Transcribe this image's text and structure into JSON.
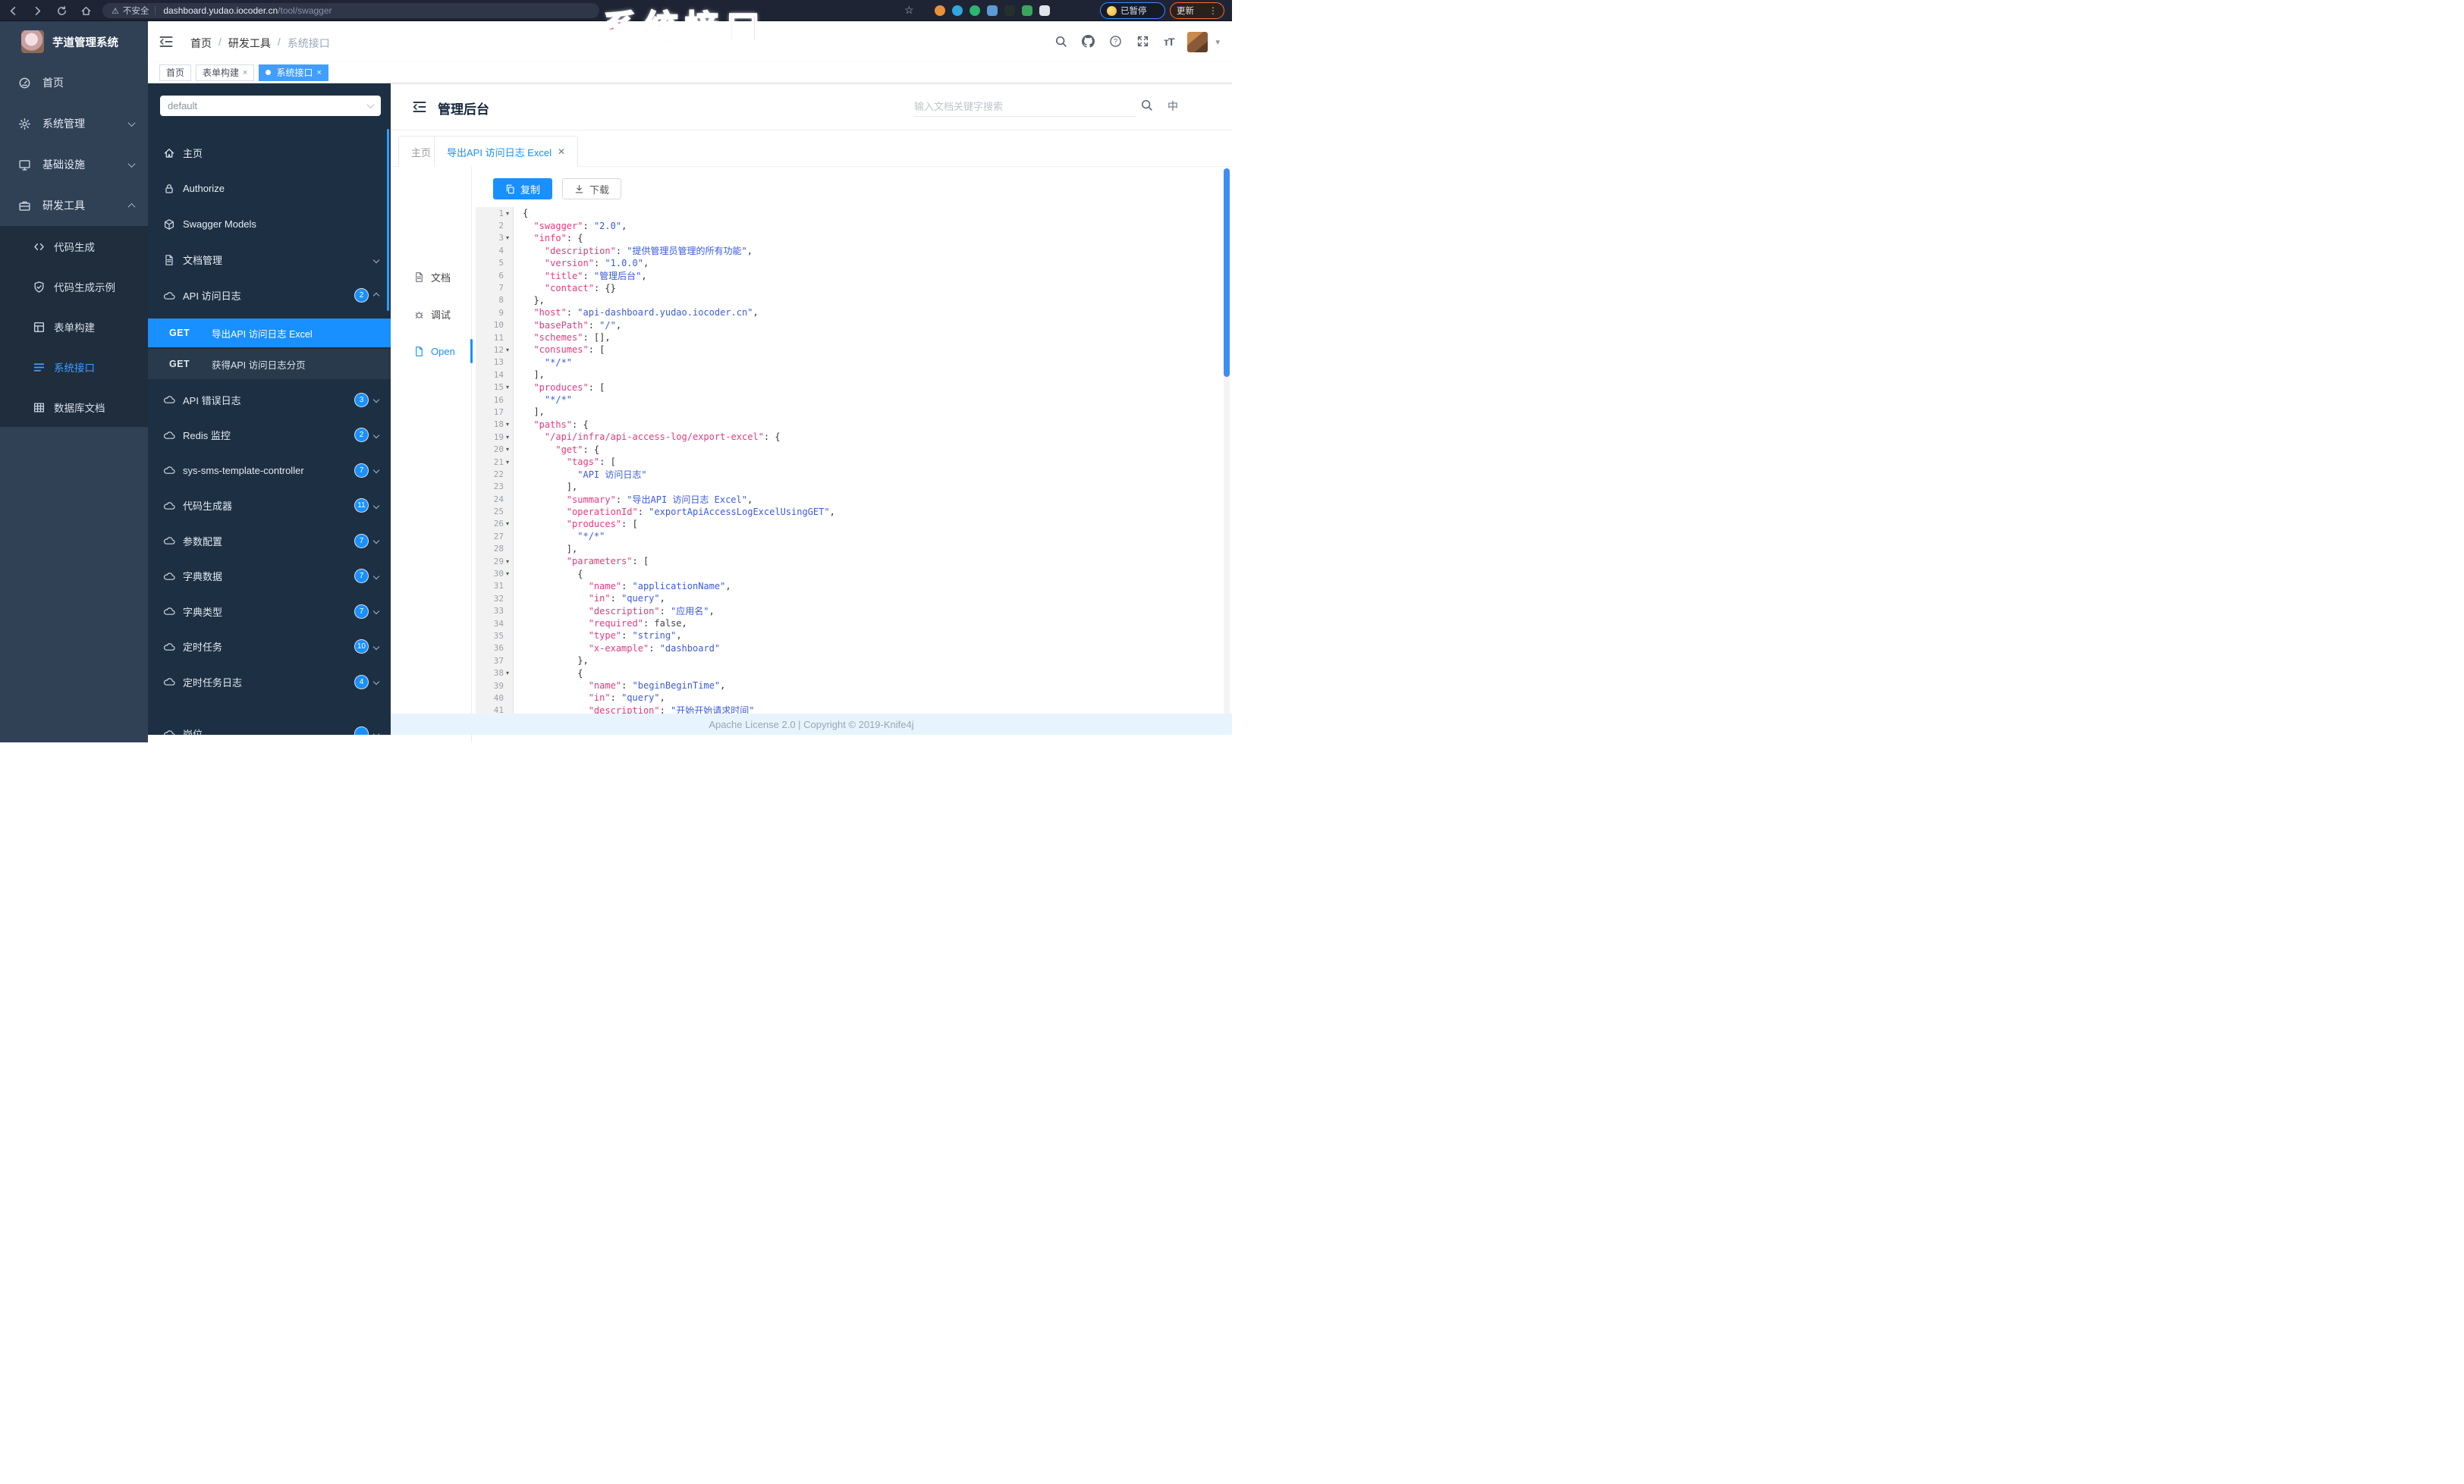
{
  "colors": {
    "accent": "#1890ff",
    "sidebar_active": "#409eff",
    "code_key": "#e5397f",
    "code_string": "#3b5bdb",
    "watermark_pink": "#f4466f",
    "sidebar_bg": "#304156",
    "submenu_bg": "#1f2d3d",
    "panel_bg": "#1d3043"
  },
  "watermark": "系统接口",
  "browser": {
    "security_label": "不安全",
    "url_domain": "dashboard.yudao.iocoder.cn",
    "url_path": "/tool/swagger",
    "paused_label": "已暂停",
    "update_label": "更新",
    "extensions": [
      {
        "name": "extension-orange",
        "color": "#e8913c"
      },
      {
        "name": "extension-blue-drop",
        "color": "#2fa8e0"
      },
      {
        "name": "extension-green-circle",
        "color": "#2bb673"
      },
      {
        "name": "extension-blue-grid",
        "color": "#5b9bd5"
      },
      {
        "name": "extension-dark-green",
        "color": "#23312a"
      },
      {
        "name": "extension-green",
        "color": "#3ba55d"
      },
      {
        "name": "extension-light-puzzle",
        "color": "#dfe5ea"
      }
    ]
  },
  "sidebar": {
    "logo_title": "芋道管理系统",
    "items": [
      {
        "label": "首页",
        "icon": "dashboard-icon"
      },
      {
        "label": "系统管理",
        "icon": "gear-icon",
        "chevron": "down"
      },
      {
        "label": "基础设施",
        "icon": "monitor-icon",
        "chevron": "down"
      },
      {
        "label": "研发工具",
        "icon": "tools-icon",
        "chevron": "up",
        "open": true,
        "children": [
          {
            "label": "代码生成",
            "icon": "code-icon"
          },
          {
            "label": "代码生成示例",
            "icon": "shield-check-icon"
          },
          {
            "label": "表单构建",
            "icon": "form-icon"
          },
          {
            "label": "系统接口",
            "icon": "swagger-icon",
            "active": true
          },
          {
            "label": "数据库文档",
            "icon": "database-icon"
          }
        ]
      }
    ]
  },
  "navbar": {
    "breadcrumb": [
      "首页",
      "研发工具",
      "系统接口"
    ],
    "right_icons": [
      "search-icon",
      "github-icon",
      "question-icon",
      "fullscreen-icon",
      "fontsize-icon"
    ]
  },
  "tags": [
    {
      "label": "首页",
      "closable": false,
      "active": false
    },
    {
      "label": "表单构建",
      "closable": true,
      "active": false
    },
    {
      "label": "系统接口",
      "closable": true,
      "active": true
    }
  ],
  "panel": {
    "group_select": "default",
    "nav": [
      {
        "label": "主页",
        "icon": "home-icon"
      },
      {
        "label": "Authorize",
        "icon": "lock-icon"
      },
      {
        "label": "Swagger Models",
        "icon": "cube-icon"
      },
      {
        "label": "文档管理",
        "icon": "doc-icon",
        "chevron": "down"
      },
      {
        "label": "API 访问日志",
        "icon": "cloud-icon",
        "badge": "2",
        "chevron": "up"
      }
    ],
    "operations": [
      {
        "method": "GET",
        "label": "导出API 访问日志 Excel",
        "active": true
      },
      {
        "method": "GET",
        "label": "获得API 访问日志分页",
        "active": false
      }
    ],
    "groups": [
      {
        "label": "API 错误日志",
        "badge": "3"
      },
      {
        "label": "Redis 监控",
        "badge": "2"
      },
      {
        "label": "sys-sms-template-controller",
        "badge": "7"
      },
      {
        "label": "代码生成器",
        "badge": "11"
      },
      {
        "label": "参数配置",
        "badge": "7"
      },
      {
        "label": "字典数据",
        "badge": "7"
      },
      {
        "label": "字典类型",
        "badge": "7"
      },
      {
        "label": "定时任务",
        "badge": "10"
      },
      {
        "label": "定时任务日志",
        "badge": "4"
      },
      {
        "label": "岗位",
        "badge": ""
      }
    ]
  },
  "doc": {
    "title": "管理后台",
    "search_placeholder": "输入文档关键字搜索",
    "lang_label": "中",
    "tabs": [
      {
        "label": "主页",
        "closable": false,
        "active": false
      },
      {
        "label": "导出API 访问日志 Excel",
        "closable": true,
        "active": true
      }
    ],
    "mini_nav": [
      {
        "label": "文档",
        "icon": "doc-icon",
        "active": false
      },
      {
        "label": "调试",
        "icon": "debug-icon",
        "active": false
      },
      {
        "label": "Open",
        "icon": "file-icon",
        "active": true
      }
    ],
    "copy_label": "复制",
    "download_label": "下载",
    "footer": "Apache License 2.0 | Copyright © 2019-Knife4j"
  },
  "code": {
    "lines": [
      {
        "n": 1,
        "f": true,
        "t": [
          [
            "p",
            "{"
          ]
        ]
      },
      {
        "n": 2,
        "f": false,
        "t": [
          [
            "p",
            "  "
          ],
          [
            "k",
            "\"swagger\""
          ],
          [
            "p",
            ": "
          ],
          [
            "s",
            "\"2.0\""
          ],
          [
            "p",
            ","
          ]
        ]
      },
      {
        "n": 3,
        "f": true,
        "t": [
          [
            "p",
            "  "
          ],
          [
            "k",
            "\"info\""
          ],
          [
            "p",
            ": {"
          ]
        ]
      },
      {
        "n": 4,
        "f": false,
        "t": [
          [
            "p",
            "    "
          ],
          [
            "k",
            "\"description\""
          ],
          [
            "p",
            ": "
          ],
          [
            "s",
            "\"提供管理员管理的所有功能\""
          ],
          [
            "p",
            ","
          ]
        ]
      },
      {
        "n": 5,
        "f": false,
        "t": [
          [
            "p",
            "    "
          ],
          [
            "k",
            "\"version\""
          ],
          [
            "p",
            ": "
          ],
          [
            "s",
            "\"1.0.0\""
          ],
          [
            "p",
            ","
          ]
        ]
      },
      {
        "n": 6,
        "f": false,
        "t": [
          [
            "p",
            "    "
          ],
          [
            "k",
            "\"title\""
          ],
          [
            "p",
            ": "
          ],
          [
            "s",
            "\"管理后台\""
          ],
          [
            "p",
            ","
          ]
        ]
      },
      {
        "n": 7,
        "f": false,
        "t": [
          [
            "p",
            "    "
          ],
          [
            "k",
            "\"contact\""
          ],
          [
            "p",
            ": {}"
          ]
        ]
      },
      {
        "n": 8,
        "f": false,
        "t": [
          [
            "p",
            "  },"
          ]
        ]
      },
      {
        "n": 9,
        "f": false,
        "t": [
          [
            "p",
            "  "
          ],
          [
            "k",
            "\"host\""
          ],
          [
            "p",
            ": "
          ],
          [
            "s",
            "\"api-dashboard.yudao.iocoder.cn\""
          ],
          [
            "p",
            ","
          ]
        ]
      },
      {
        "n": 10,
        "f": false,
        "t": [
          [
            "p",
            "  "
          ],
          [
            "k",
            "\"basePath\""
          ],
          [
            "p",
            ": "
          ],
          [
            "s",
            "\"/\""
          ],
          [
            "p",
            ","
          ]
        ]
      },
      {
        "n": 11,
        "f": false,
        "t": [
          [
            "p",
            "  "
          ],
          [
            "k",
            "\"schemes\""
          ],
          [
            "p",
            ": [],"
          ]
        ]
      },
      {
        "n": 12,
        "f": true,
        "t": [
          [
            "p",
            "  "
          ],
          [
            "k",
            "\"consumes\""
          ],
          [
            "p",
            ": ["
          ]
        ]
      },
      {
        "n": 13,
        "f": false,
        "t": [
          [
            "p",
            "    "
          ],
          [
            "s",
            "\"*/*\""
          ]
        ]
      },
      {
        "n": 14,
        "f": false,
        "t": [
          [
            "p",
            "  ],"
          ]
        ]
      },
      {
        "n": 15,
        "f": true,
        "t": [
          [
            "p",
            "  "
          ],
          [
            "k",
            "\"produces\""
          ],
          [
            "p",
            ": ["
          ]
        ]
      },
      {
        "n": 16,
        "f": false,
        "t": [
          [
            "p",
            "    "
          ],
          [
            "s",
            "\"*/*\""
          ]
        ]
      },
      {
        "n": 17,
        "f": false,
        "t": [
          [
            "p",
            "  ],"
          ]
        ]
      },
      {
        "n": 18,
        "f": true,
        "t": [
          [
            "p",
            "  "
          ],
          [
            "k",
            "\"paths\""
          ],
          [
            "p",
            ": {"
          ]
        ]
      },
      {
        "n": 19,
        "f": true,
        "t": [
          [
            "p",
            "    "
          ],
          [
            "k",
            "\"/api/infra/api-access-log/export-excel\""
          ],
          [
            "p",
            ": {"
          ]
        ]
      },
      {
        "n": 20,
        "f": true,
        "t": [
          [
            "p",
            "      "
          ],
          [
            "k",
            "\"get\""
          ],
          [
            "p",
            ": {"
          ]
        ]
      },
      {
        "n": 21,
        "f": true,
        "t": [
          [
            "p",
            "        "
          ],
          [
            "k",
            "\"tags\""
          ],
          [
            "p",
            ": ["
          ]
        ]
      },
      {
        "n": 22,
        "f": false,
        "t": [
          [
            "p",
            "          "
          ],
          [
            "s",
            "\"API 访问日志\""
          ]
        ]
      },
      {
        "n": 23,
        "f": false,
        "t": [
          [
            "p",
            "        ],"
          ]
        ]
      },
      {
        "n": 24,
        "f": false,
        "t": [
          [
            "p",
            "        "
          ],
          [
            "k",
            "\"summary\""
          ],
          [
            "p",
            ": "
          ],
          [
            "s",
            "\"导出API 访问日志 Excel\""
          ],
          [
            "p",
            ","
          ]
        ]
      },
      {
        "n": 25,
        "f": false,
        "t": [
          [
            "p",
            "        "
          ],
          [
            "k",
            "\"operationId\""
          ],
          [
            "p",
            ": "
          ],
          [
            "s",
            "\"exportApiAccessLogExcelUsingGET\""
          ],
          [
            "p",
            ","
          ]
        ]
      },
      {
        "n": 26,
        "f": true,
        "t": [
          [
            "p",
            "        "
          ],
          [
            "k",
            "\"produces\""
          ],
          [
            "p",
            ": ["
          ]
        ]
      },
      {
        "n": 27,
        "f": false,
        "t": [
          [
            "p",
            "          "
          ],
          [
            "s",
            "\"*/*\""
          ]
        ]
      },
      {
        "n": 28,
        "f": false,
        "t": [
          [
            "p",
            "        ],"
          ]
        ]
      },
      {
        "n": 29,
        "f": true,
        "t": [
          [
            "p",
            "        "
          ],
          [
            "k",
            "\"parameters\""
          ],
          [
            "p",
            ": ["
          ]
        ]
      },
      {
        "n": 30,
        "f": true,
        "t": [
          [
            "p",
            "          {"
          ]
        ]
      },
      {
        "n": 31,
        "f": false,
        "t": [
          [
            "p",
            "            "
          ],
          [
            "k",
            "\"name\""
          ],
          [
            "p",
            ": "
          ],
          [
            "s",
            "\"applicationName\""
          ],
          [
            "p",
            ","
          ]
        ]
      },
      {
        "n": 32,
        "f": false,
        "t": [
          [
            "p",
            "            "
          ],
          [
            "k",
            "\"in\""
          ],
          [
            "p",
            ": "
          ],
          [
            "s",
            "\"query\""
          ],
          [
            "p",
            ","
          ]
        ]
      },
      {
        "n": 33,
        "f": false,
        "t": [
          [
            "p",
            "            "
          ],
          [
            "k",
            "\"description\""
          ],
          [
            "p",
            ": "
          ],
          [
            "s",
            "\"应用名\""
          ],
          [
            "p",
            ","
          ]
        ]
      },
      {
        "n": 34,
        "f": false,
        "t": [
          [
            "p",
            "            "
          ],
          [
            "k",
            "\"required\""
          ],
          [
            "p",
            ": "
          ],
          [
            "b",
            "false"
          ],
          [
            "p",
            ","
          ]
        ]
      },
      {
        "n": 35,
        "f": false,
        "t": [
          [
            "p",
            "            "
          ],
          [
            "k",
            "\"type\""
          ],
          [
            "p",
            ": "
          ],
          [
            "s",
            "\"string\""
          ],
          [
            "p",
            ","
          ]
        ]
      },
      {
        "n": 36,
        "f": false,
        "t": [
          [
            "p",
            "            "
          ],
          [
            "k",
            "\"x-example\""
          ],
          [
            "p",
            ": "
          ],
          [
            "s",
            "\"dashboard\""
          ]
        ]
      },
      {
        "n": 37,
        "f": false,
        "t": [
          [
            "p",
            "          },"
          ]
        ]
      },
      {
        "n": 38,
        "f": true,
        "t": [
          [
            "p",
            "          {"
          ]
        ]
      },
      {
        "n": 39,
        "f": false,
        "t": [
          [
            "p",
            "            "
          ],
          [
            "k",
            "\"name\""
          ],
          [
            "p",
            ": "
          ],
          [
            "s",
            "\"beginBeginTime\""
          ],
          [
            "p",
            ","
          ]
        ]
      },
      {
        "n": 40,
        "f": false,
        "t": [
          [
            "p",
            "            "
          ],
          [
            "k",
            "\"in\""
          ],
          [
            "p",
            ": "
          ],
          [
            "s",
            "\"query\""
          ],
          [
            "p",
            ","
          ]
        ]
      },
      {
        "n": 41,
        "f": false,
        "t": [
          [
            "p",
            "            "
          ],
          [
            "k",
            "\"description\""
          ],
          [
            "p",
            ": "
          ],
          [
            "s",
            "\"开始开始请求时间\""
          ]
        ]
      }
    ]
  }
}
